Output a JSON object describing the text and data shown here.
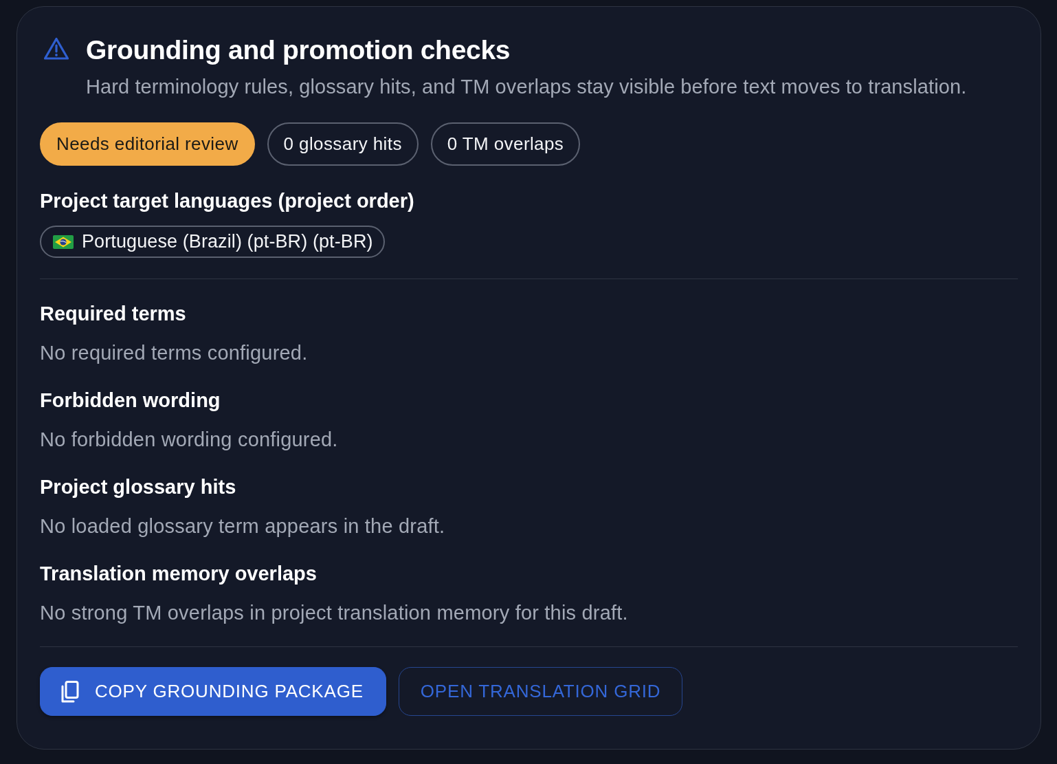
{
  "card": {
    "title": "Grounding and promotion checks",
    "subtitle": "Hard terminology rules, glossary hits, and TM overlaps stay visible before text moves to translation.",
    "badges": [
      {
        "label": "Needs editorial review",
        "kind": "status"
      },
      {
        "label": "0 glossary hits",
        "kind": "count"
      },
      {
        "label": "0 TM overlaps",
        "kind": "count"
      }
    ],
    "target_languages": {
      "heading": "Project target languages (project order)",
      "items": [
        {
          "label": "Portuguese (Brazil) (pt-BR) (pt-BR)"
        }
      ]
    },
    "sections": [
      {
        "heading": "Required terms",
        "text": "No required terms configured."
      },
      {
        "heading": "Forbidden wording",
        "text": "No forbidden wording configured."
      },
      {
        "heading": "Project glossary hits",
        "text": "No loaded glossary term appears in the draft."
      },
      {
        "heading": "Translation memory overlaps",
        "text": "No strong TM overlaps in project translation memory for this draft."
      }
    ],
    "buttons": [
      {
        "label": "COPY GROUNDING PACKAGE",
        "kind": "primary"
      },
      {
        "label": "OPEN TRANSLATION GRID",
        "kind": "outlined"
      }
    ]
  }
}
